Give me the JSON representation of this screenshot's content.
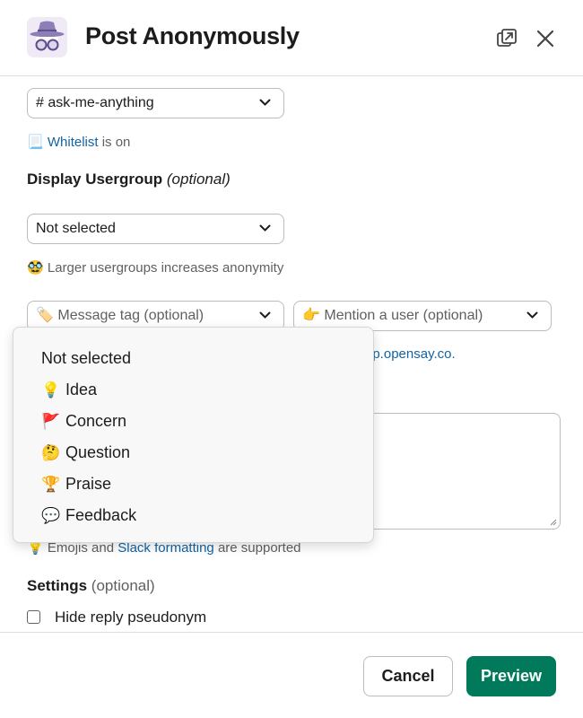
{
  "header": {
    "title": "Post Anonymously",
    "app_icon": "incognito-spy-icon",
    "popout_icon": "popout-icon",
    "close_icon": "close-icon"
  },
  "channel_select": {
    "value": "# ask-me-anything"
  },
  "whitelist": {
    "emoji": "📃",
    "link": "Whitelist",
    "middle": " is ",
    "state": "on"
  },
  "usergroup": {
    "label": "Display Usergroup",
    "optional": "(optional)",
    "value": "Not selected",
    "hint_emoji": "🥸",
    "hint": "Larger usergroups increases anonymity"
  },
  "message_tag": {
    "emoji": "🏷️",
    "placeholder": "Message tag (optional)"
  },
  "mention_user": {
    "emoji": "👉",
    "placeholder": "Mention a user (optional)"
  },
  "partial_link": "pp.opensay.co.",
  "dropdown": {
    "items": [
      {
        "emoji": "",
        "label": "Not selected"
      },
      {
        "emoji": "💡",
        "label": "Idea"
      },
      {
        "emoji": "🚩",
        "label": "Concern"
      },
      {
        "emoji": "🤔",
        "label": "Question"
      },
      {
        "emoji": "🏆",
        "label": "Praise"
      },
      {
        "emoji": "💬",
        "label": "Feedback"
      }
    ]
  },
  "formatting": {
    "emoji": "💡",
    "pre": "Emojis and ",
    "link": "Slack formatting",
    "post": " are supported"
  },
  "settings": {
    "label": "Settings",
    "optional": "(optional)",
    "hide_reply": "Hide reply pseudonym"
  },
  "footer": {
    "cancel": "Cancel",
    "preview": "Preview"
  },
  "colors": {
    "primary": "#007a5a",
    "link": "#1264a3",
    "text": "#1d1c1d",
    "muted": "#616061"
  }
}
